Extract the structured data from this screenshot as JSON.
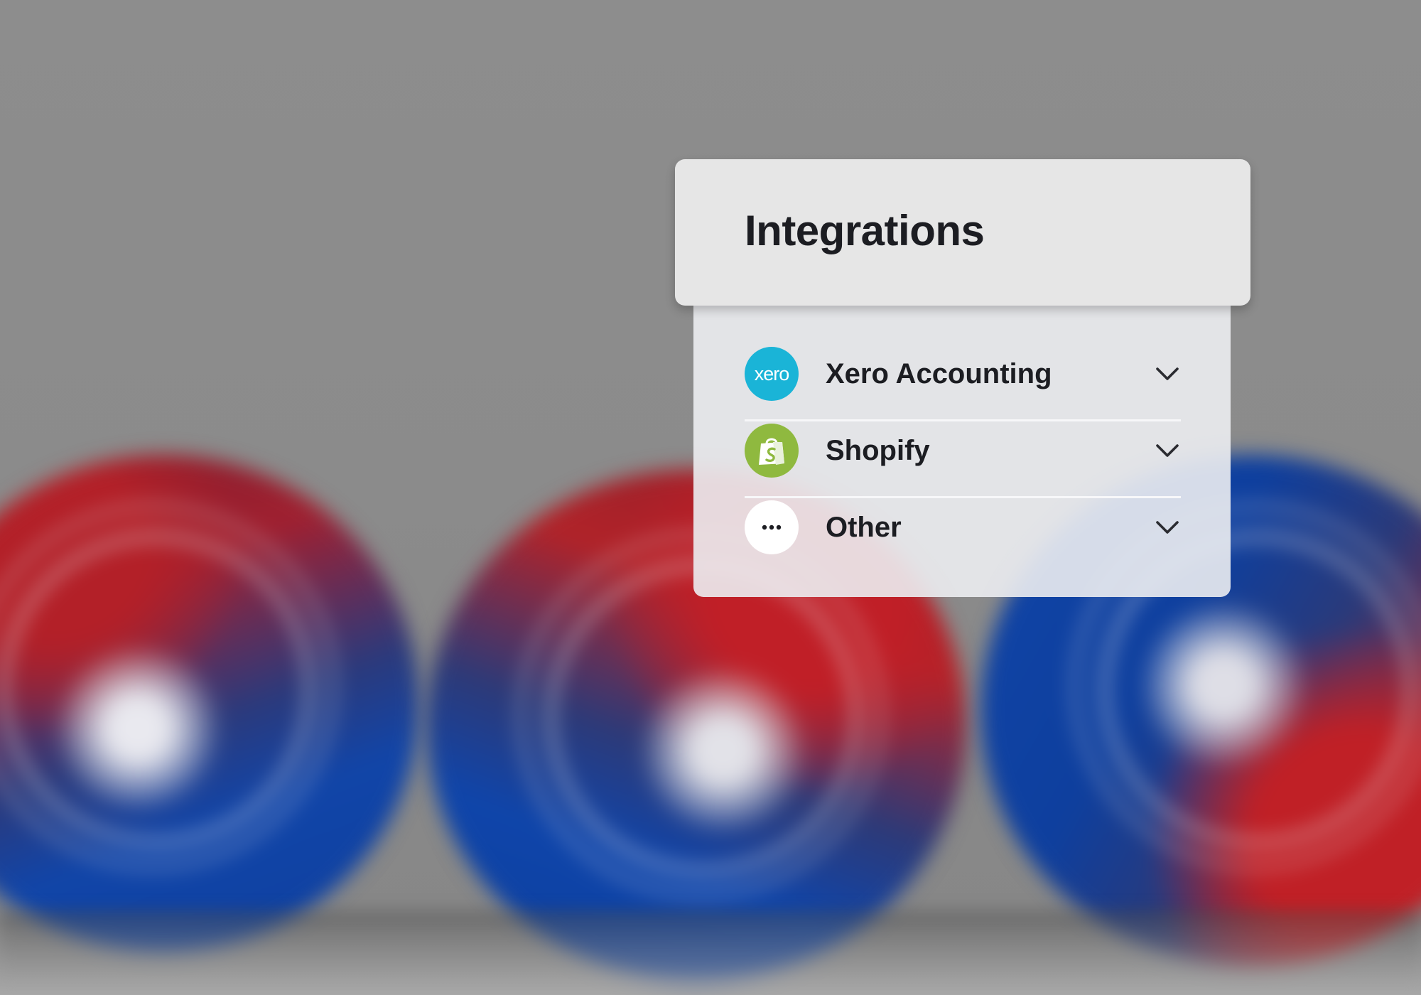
{
  "panel": {
    "title": "Integrations",
    "items": [
      {
        "label": "Xero Accounting",
        "icon": "xero-logo-icon",
        "logo_text": "xero",
        "color": "#1ab4d7"
      },
      {
        "label": "Shopify",
        "icon": "shopify-logo-icon",
        "color": "#8fb93f"
      },
      {
        "label": "Other",
        "icon": "more-dots-icon",
        "color": "#ffffff"
      }
    ],
    "expand_icon": "chevron-down-icon"
  },
  "colors": {
    "header_bg": "#e6e6e6",
    "text": "#1c1d22",
    "background": "#8c8c8c"
  }
}
